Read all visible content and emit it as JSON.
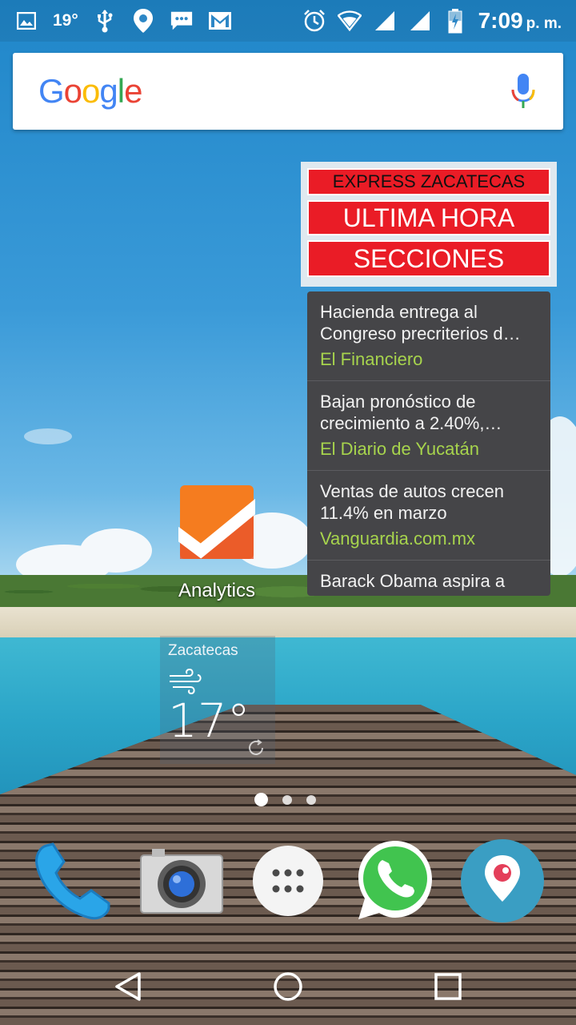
{
  "status_bar": {
    "temperature": "19°",
    "time": "7:09",
    "ampm": "p. m.",
    "left_icons": [
      "gallery-icon",
      "usb-icon",
      "location-icon",
      "sms-icon",
      "gmail-icon"
    ],
    "right_icons": [
      "alarm-icon",
      "wifi-icon",
      "signal-icon",
      "signal-icon",
      "battery-charging-icon"
    ]
  },
  "search": {
    "logo_text": "Google",
    "logo_colors": [
      "#4285F4",
      "#EA4335",
      "#FBBC05",
      "#4285F4",
      "#34A853",
      "#EA4335"
    ]
  },
  "news_widget": {
    "buttons": [
      "EXPRESS ZACATECAS",
      "ULTIMA HORA",
      "SECCIONES"
    ],
    "accent": "#EA1C26",
    "source_color": "#A7D44D",
    "items": [
      {
        "headline": "Hacienda entrega al Congreso precriterios d…",
        "source": "El Financiero"
      },
      {
        "headline": "Bajan pronóstico de crecimiento a 2.40%,…",
        "source": "El Diario de Yucatán"
      },
      {
        "headline": "Ventas de autos crecen 11.4% en marzo",
        "source": "Vanguardia.com.mx"
      },
      {
        "headline": "Barack Obama aspira a",
        "source": ""
      }
    ]
  },
  "apps": {
    "analytics_label": "Analytics"
  },
  "weather": {
    "city": "Zacatecas",
    "temperature": "17°",
    "condition_icon": "wind-icon"
  },
  "page_indicator": {
    "pages": 3,
    "active": 0
  },
  "dock": [
    "phone-icon",
    "camera-icon",
    "app-drawer-icon",
    "whatsapp-icon",
    "periscope-icon"
  ],
  "nav": [
    "back-icon",
    "home-icon",
    "recents-icon"
  ]
}
